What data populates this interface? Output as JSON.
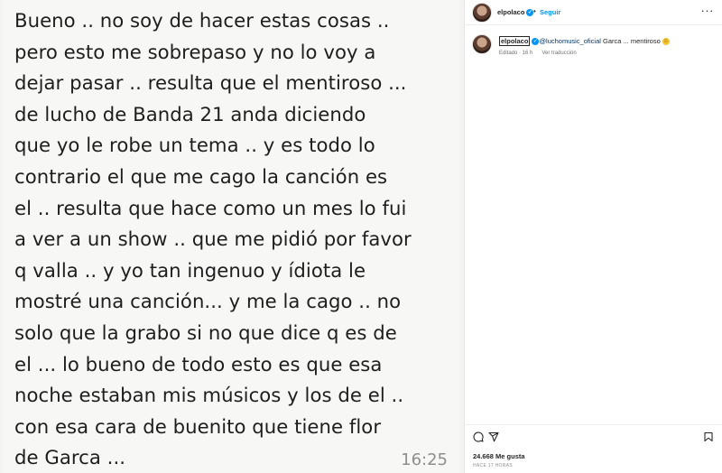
{
  "chat": {
    "lines": [
      "Bueno .. no soy de hacer estas cosas ..",
      "pero esto me sobrepaso y no lo voy a",
      "dejar pasar .. resulta que el mentiroso ...",
      "de lucho de Banda 21 anda diciendo",
      "que yo le robe un tema .. y es todo lo",
      "contrario el que me cago la canción es",
      "el .. resulta que hace como un mes lo fui",
      "a ver a un show .. que me pidió por favor",
      "q valla .. y yo tan ingenuo y ídiota le",
      "mostré una canción... y me la cago .. no",
      "solo que la grabo si no que dice q es de",
      "el ... lo bueno de todo esto es que esa",
      "noche estaban mis músicos y los de el ..",
      "con esa cara de buenito que tiene flor",
      "de Garca ..."
    ],
    "time": "16:25"
  },
  "post": {
    "header": {
      "username": "elpolaco",
      "separator": "•",
      "follow_label": "Seguir",
      "more_label": "···"
    },
    "caption": {
      "username": "elpolaco",
      "mention": "@luchomusic_oficial",
      "text": " Garca ... mentiroso ",
      "emoji": "☺",
      "edited": "Editado · 16 h",
      "translate_label": "Ver traducción"
    },
    "likes": "24.668 Me gusta",
    "time_ago": "HACE 17 HORAS"
  },
  "icons": {
    "verified": "verified-badge-icon",
    "comment": "comment-icon",
    "share": "share-icon",
    "save": "bookmark-icon"
  },
  "colors": {
    "accent": "#0095f6",
    "mention": "#00376b"
  }
}
